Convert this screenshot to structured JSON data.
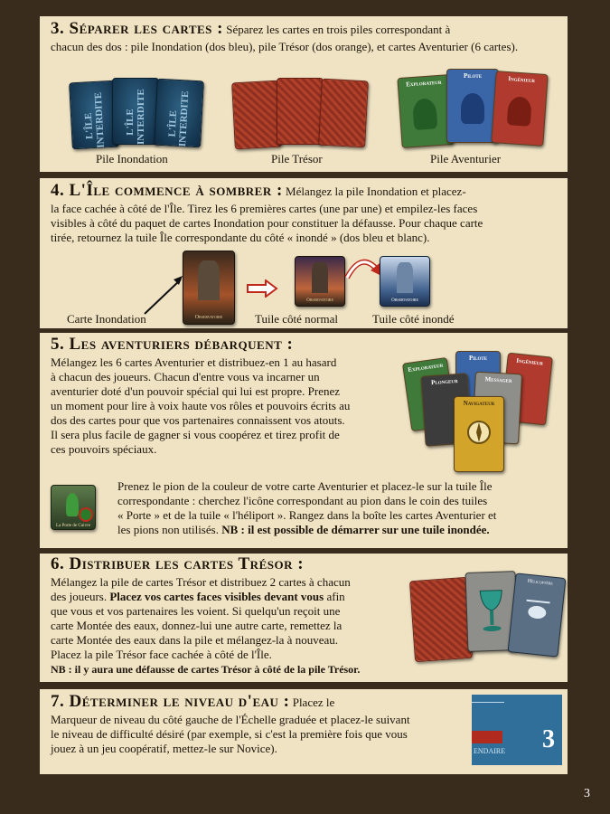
{
  "s3": {
    "title": "3. Séparer les cartes :",
    "text1": "Séparez les cartes en trois piles correspondant à",
    "text2": "chacun des dos : pile Inondation (dos bleu), pile Trésor (dos orange), et cartes Aventurier (6 cartes).",
    "cap_flood": "Pile Inondation",
    "cap_treasure": "Pile Trésor",
    "cap_adv": "Pile Aventurier",
    "flood_logo": "L'ÎLE INTERDITE",
    "adv_cards": [
      "Explorateur",
      "Pilote",
      "Ingénieur"
    ]
  },
  "s4": {
    "title": "4. L'Île commence à sombrer :",
    "text1": "Mélangez la pile Inondation et placez-",
    "text2": "la face cachée à côté de l'Île. Tirez les 6 premières cartes (une par une) et empilez-les faces",
    "text3": "visibles à côté du paquet de cartes Inondation pour constituer la défausse. Pour chaque carte",
    "text4": "tirée, retournez la tuile Île correspondante du côté « inondé » (dos bleu et blanc).",
    "cap_card": "Carte Inondation",
    "cap_normal": "Tuile côté normal",
    "cap_flooded": "Tuile côté inondé",
    "tile_label": "Observatoire"
  },
  "s5": {
    "title": "5. Les aventuriers débarquent :",
    "para1": [
      "Mélangez les 6 cartes Aventurier et distribuez-en 1 au hasard",
      "à chacun des joueurs. Chacun d'entre vous va incarner un",
      "aventurier doté d'un pouvoir spécial qui lui est propre. Prenez",
      "un moment pour lire à voix haute vos rôles et pouvoirs écrits au",
      "dos des cartes pour que vos partenaires connaissent vos atouts.",
      "Il sera plus facile de gagner si vous coopérez et tirez profit de",
      "ces pouvoirs spéciaux."
    ],
    "para2": [
      "Prenez le pion de la couleur de votre carte Aventurier et placez-le sur la tuile Île",
      "correspondante : cherchez l'icône correspondant au pion dans le coin des tuiles",
      "« Porte » et de la tuile « l'héliport ». Rangez dans la boîte les cartes Aventurier et",
      "les pions non utilisés. "
    ],
    "nb": "NB : il est possible de démarrer sur une tuile inondée.",
    "adv_cards": [
      "Explorateur",
      "Pilote",
      "Ingénieur",
      "Plongeur",
      "Messager",
      "Navigateur"
    ],
    "tile_label": "La Porte de Cuivre"
  },
  "s6": {
    "title": "6. Distribuer les cartes Trésor :",
    "para": [
      "Mélangez la pile de cartes Trésor et distribuez 2 cartes à chacun",
      "des joueurs. ",
      "que vous et vos partenaires les voient. Si quelqu'un reçoit une",
      "carte Montée des eaux, donnez-lui une autre carte, remettez la",
      "carte Montée des eaux dans la pile et mélangez-la à nouveau.",
      "Placez la pile Trésor face cachée à côté de l'Île."
    ],
    "bold": "Placez vos cartes faces visibles devant vous",
    "bold_after": " afin",
    "nb": "NB : il y aura une défausse de cartes Trésor à côté de la pile Trésor.",
    "card_label": "Hélicoptère"
  },
  "s7": {
    "title": "7. Déterminer le niveau d'eau :",
    "text1": "Placez le",
    "para": [
      "Marqueur de niveau du côté gauche de l'Échelle graduée et placez-le suivant",
      "le niveau de difficulté désiré (par exemple, si c'est la première fois que vous",
      "jouez à un jeu coopératif, mettez-le sur Novice)."
    ],
    "meter_label": "ENDAIRE",
    "meter_level": "3"
  },
  "page_number": "3"
}
